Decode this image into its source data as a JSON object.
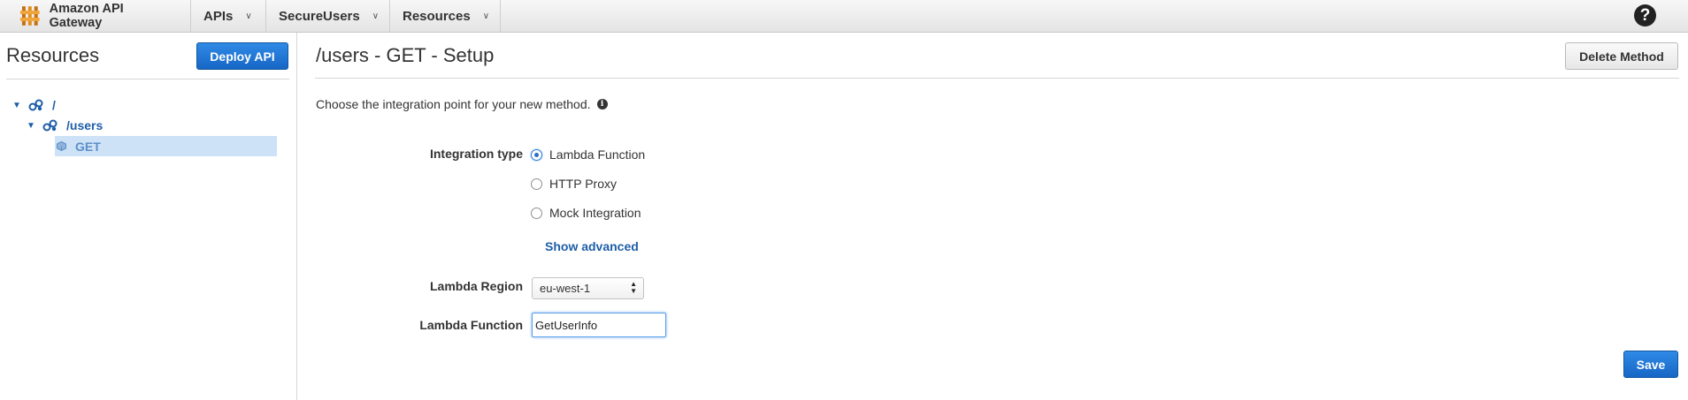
{
  "topbar": {
    "brand": "Amazon API Gateway",
    "menus": [
      {
        "label": "APIs"
      },
      {
        "label": "SecureUsers"
      },
      {
        "label": "Resources"
      }
    ],
    "help_glyph": "?"
  },
  "left": {
    "title": "Resources",
    "deploy_label": "Deploy API",
    "tree": {
      "root": "/",
      "child": "/users",
      "method": "GET"
    }
  },
  "main": {
    "title": "/users - GET - Setup",
    "delete_label": "Delete Method",
    "intro": "Choose the integration point for your new method.",
    "integration_type_label": "Integration type",
    "options": [
      {
        "label": "Lambda Function",
        "selected": true
      },
      {
        "label": "HTTP Proxy",
        "selected": false
      },
      {
        "label": "Mock Integration",
        "selected": false
      }
    ],
    "show_advanced": "Show advanced",
    "region_label": "Lambda Region",
    "region_value": "eu-west-1",
    "function_label": "Lambda Function",
    "function_value": "GetUserInfo",
    "save_label": "Save"
  },
  "colors": {
    "accent": "#1e5ea8",
    "primary_button": "#1f74d4",
    "selected_row": "#cde2f7",
    "logo": "#e08f1e"
  },
  "icons": [
    "api-gateway-logo-icon",
    "chevron-down-icon",
    "help-icon",
    "resource-icon",
    "method-icon",
    "info-icon",
    "select-arrows-icon"
  ]
}
